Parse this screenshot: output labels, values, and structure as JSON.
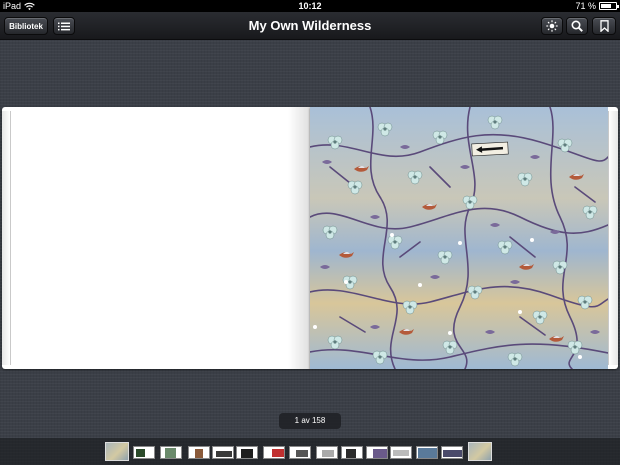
{
  "status_bar": {
    "carrier": "iPad",
    "time": "10:12",
    "battery": "71 %",
    "battery_level": 0.71
  },
  "toolbar": {
    "library_label": "Bibliotek",
    "title": "My Own Wilderness"
  },
  "icons": {
    "wifi": "wifi-icon",
    "battery": "battery-icon",
    "list": "list-icon",
    "brightness": "brightness-icon",
    "search": "search-icon",
    "bookmark": "bookmark-icon"
  },
  "book": {
    "artwork": "floral-wallpaper-artwork",
    "artwork_sign": "arrow-sign",
    "colors": {
      "sky_blue": "#9fb9d3",
      "sand": "#d9c79a",
      "branch": "#5a4a7a",
      "blossom": "#cfe8e6",
      "bird": "#b45a3a"
    }
  },
  "navigation": {
    "page_indicator": "1 av 158"
  },
  "thumbnails": [
    {
      "name": "thumb-1",
      "current": true
    },
    {
      "name": "thumb-2"
    },
    {
      "name": "thumb-3"
    },
    {
      "name": "thumb-4"
    },
    {
      "name": "thumb-5"
    },
    {
      "name": "thumb-6"
    },
    {
      "name": "thumb-7"
    },
    {
      "name": "thumb-8"
    },
    {
      "name": "thumb-9"
    },
    {
      "name": "thumb-10"
    },
    {
      "name": "thumb-11"
    },
    {
      "name": "thumb-12"
    },
    {
      "name": "thumb-13"
    },
    {
      "name": "thumb-14"
    },
    {
      "name": "thumb-15",
      "current": true
    }
  ]
}
